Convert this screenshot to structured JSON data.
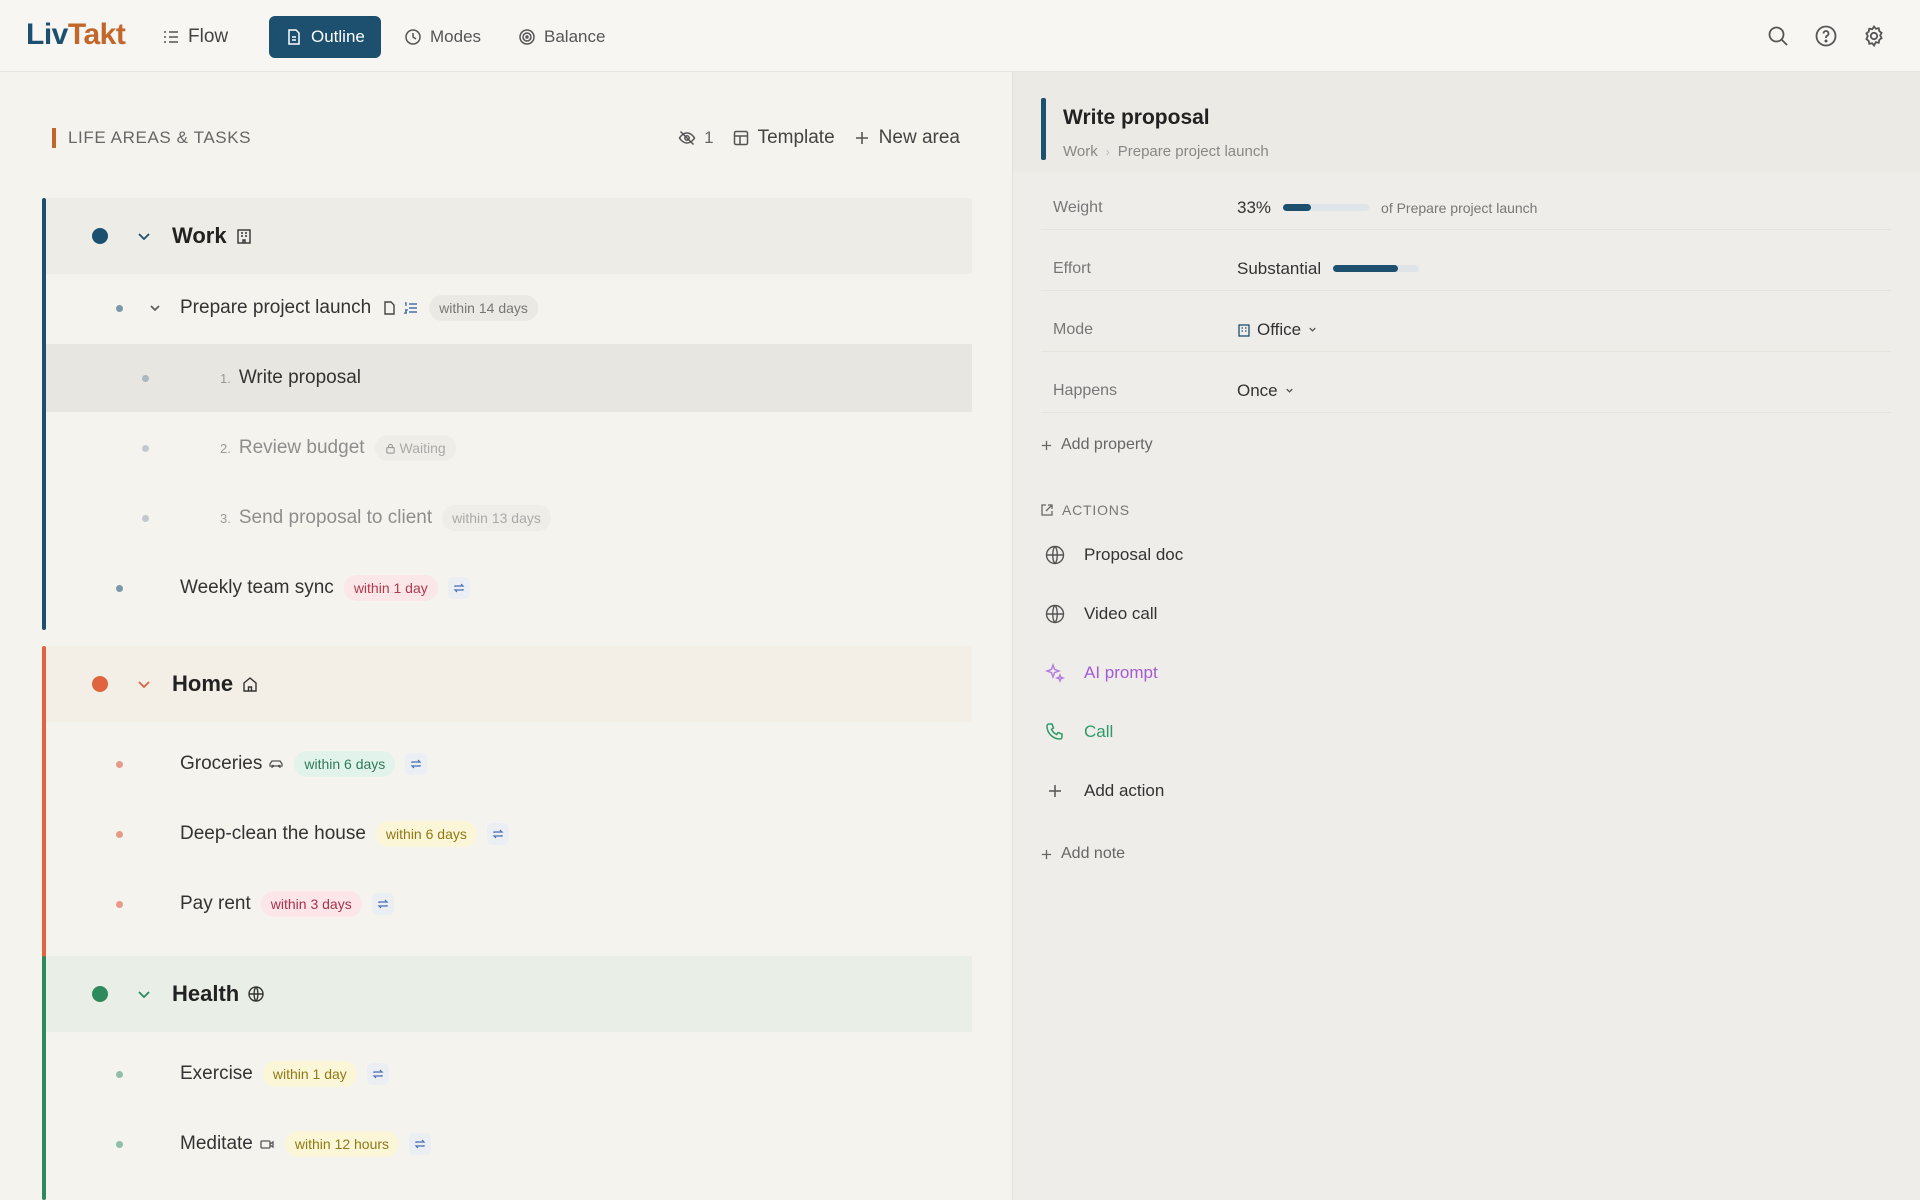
{
  "app": {
    "logo_part1": "Liv",
    "logo_part2": "Takt"
  },
  "nav": [
    {
      "label": "Flow",
      "icon": "list-icon",
      "active": false
    },
    {
      "label": "Outline",
      "icon": "document-icon",
      "active": true
    },
    {
      "label": "Modes",
      "icon": "clock-icon",
      "active": false
    },
    {
      "label": "Balance",
      "icon": "target-icon",
      "active": false
    }
  ],
  "toolbar_icons": [
    "search-icon",
    "help-icon",
    "gear-icon"
  ],
  "left": {
    "section_title": "LIFE AREAS & TASKS",
    "hidden_count": "1",
    "template_label": "Template",
    "new_area_label": "New area"
  },
  "areas": [
    {
      "name": "Work",
      "color": "#1d4f6e",
      "icon": "building-icon",
      "tasks": [
        {
          "label": "Prepare project launch",
          "badge": "within 14 days"
        },
        {
          "num": "1.",
          "label": "Write proposal"
        },
        {
          "num": "2.",
          "label": "Review budget",
          "badge": "Waiting"
        },
        {
          "num": "3.",
          "label": "Send proposal to client",
          "badge": "within 13 days"
        },
        {
          "label": "Weekly team sync",
          "badge": "within 1 day"
        }
      ]
    },
    {
      "name": "Home",
      "color": "#e0643f",
      "icon": "home-icon",
      "tasks": [
        {
          "label": "Groceries",
          "badge": "within 6 days"
        },
        {
          "label": "Deep-clean the house",
          "badge": "within 6 days"
        },
        {
          "label": "Pay rent",
          "badge": "within 3 days"
        }
      ]
    },
    {
      "name": "Health",
      "color": "#2e8a5c",
      "icon": "globe-icon",
      "tasks": [
        {
          "label": "Exercise",
          "badge": "within 1 day"
        },
        {
          "label": "Meditate",
          "badge": "within 12 hours"
        }
      ]
    }
  ],
  "detail": {
    "title": "Write proposal",
    "crumb_area": "Work",
    "crumb_parent": "Prepare project launch",
    "weight_label": "Weight",
    "weight_value": "33%",
    "weight_fraction": 0.33,
    "weight_note": "of Prepare project launch",
    "effort_label": "Effort",
    "effort_value": "Substantial",
    "effort_fraction": 0.75,
    "mode_label": "Mode",
    "mode_value": "Office",
    "happens_label": "Happens",
    "happens_value": "Once",
    "add_property": "Add property",
    "actions_title": "ACTIONS",
    "actions": [
      {
        "label": "Proposal doc",
        "icon": "globe-icon",
        "color": "#333333"
      },
      {
        "label": "Video call",
        "icon": "globe-icon",
        "color": "#333333"
      },
      {
        "label": "AI prompt",
        "icon": "sparkle-icon",
        "color": "#a35bd6"
      },
      {
        "label": "Call",
        "icon": "phone-icon",
        "color": "#2e9a68"
      }
    ],
    "add_action": "Add action",
    "add_note": "Add note"
  }
}
